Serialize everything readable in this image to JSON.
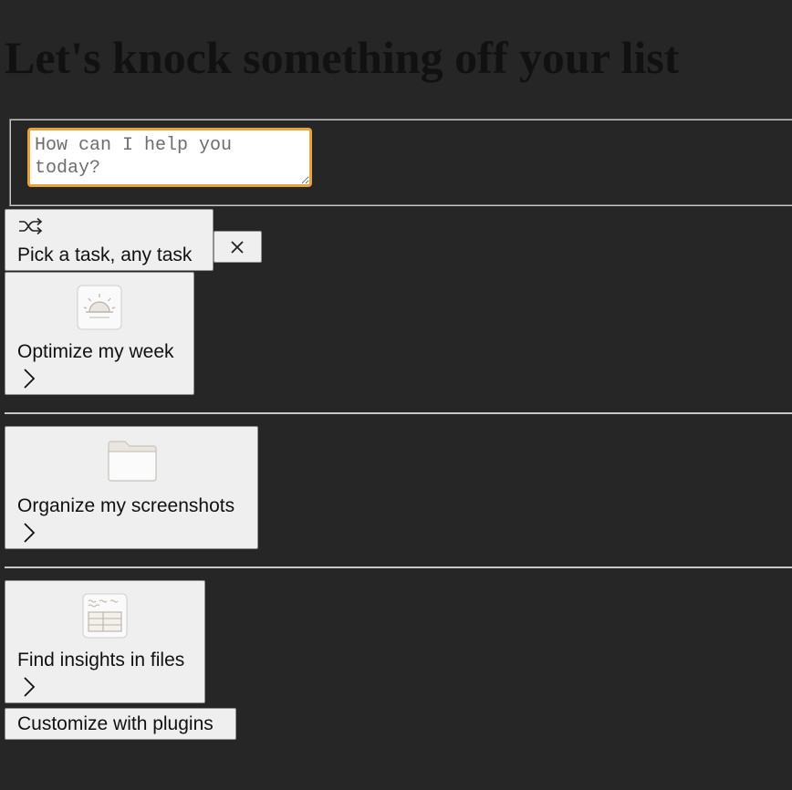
{
  "heading": "Let's knock something off your list",
  "prompt": {
    "placeholder": "How can I help you today?"
  },
  "shuffle": {
    "label": "Pick a task, any task",
    "icon": "shuffle-icon"
  },
  "close": {
    "glyph": "×",
    "icon": "close-icon"
  },
  "tasks": [
    {
      "label": "Optimize my week",
      "icon": "sunrise-icon"
    },
    {
      "label": "Organize my screenshots",
      "icon": "folder-icon"
    },
    {
      "label": "Find insights in files",
      "icon": "spreadsheet-icon"
    }
  ],
  "plugins": {
    "label": "Customize with plugins"
  },
  "colors": {
    "page_background": "#262626",
    "input_focus_border": "#e8a33d",
    "button_background": "#efefef",
    "text": "#111111"
  }
}
